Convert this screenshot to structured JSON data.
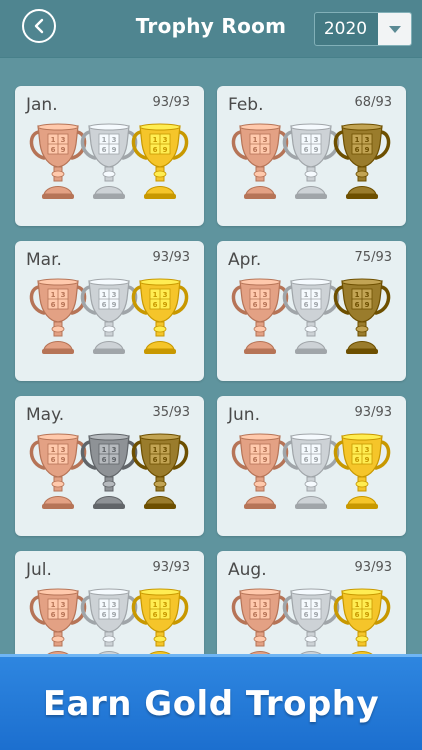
{
  "header": {
    "back_icon": "back-arrow-icon",
    "title": "Trophy Room",
    "year_selected": "2020",
    "dropdown_icon": "chevron-down-icon"
  },
  "months": [
    {
      "month": "Jan.",
      "count": "93/93",
      "trophies": [
        "bronze",
        "silver",
        "gold"
      ]
    },
    {
      "month": "Feb.",
      "count": "68/93",
      "trophies": [
        "bronze",
        "silver",
        "dark-gold"
      ]
    },
    {
      "month": "Mar.",
      "count": "93/93",
      "trophies": [
        "bronze",
        "silver",
        "gold"
      ]
    },
    {
      "month": "Apr.",
      "count": "75/93",
      "trophies": [
        "bronze",
        "silver",
        "dark-gold"
      ]
    },
    {
      "month": "May.",
      "count": "35/93",
      "trophies": [
        "bronze",
        "dark-silver",
        "dark-gold"
      ]
    },
    {
      "month": "Jun.",
      "count": "93/93",
      "trophies": [
        "bronze",
        "silver",
        "gold"
      ]
    },
    {
      "month": "Jul.",
      "count": "93/93",
      "trophies": [
        "bronze",
        "silver",
        "gold"
      ]
    },
    {
      "month": "Aug.",
      "count": "93/93",
      "trophies": [
        "bronze",
        "silver",
        "gold"
      ]
    }
  ],
  "trophy_digits": [
    "1",
    "3",
    "6",
    "9"
  ],
  "colors": {
    "bronze": "#e3a184",
    "silver": "#cdd2d6",
    "gold": "#f5c52a",
    "dark-gold": "#9a7c2c",
    "dark-silver": "#8e9296",
    "background": "#5f949e",
    "banner": "#2378d8"
  },
  "banner": {
    "text": "Earn Gold Trophy"
  }
}
